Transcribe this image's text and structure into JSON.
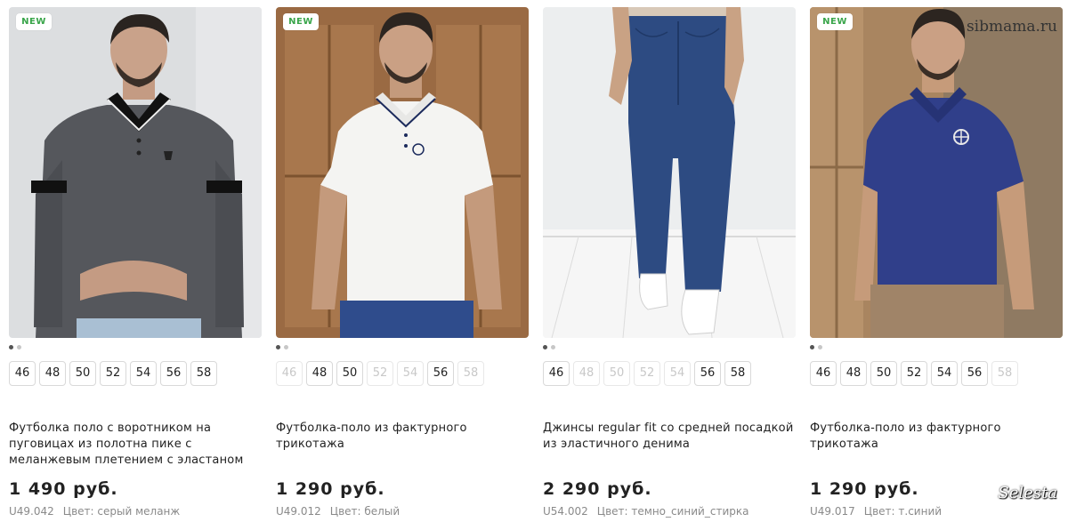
{
  "products": [
    {
      "badge": "NEW",
      "title": "Футболка поло с воротником на пуговицах из полотна пике с меланжевым плетением с эластаном",
      "price": "1 490 руб.",
      "sku": "U49.042",
      "color_label": "Цвет: серый меланж",
      "sizes": [
        {
          "label": "46",
          "available": true
        },
        {
          "label": "48",
          "available": true
        },
        {
          "label": "50",
          "available": true
        },
        {
          "label": "52",
          "available": true
        },
        {
          "label": "54",
          "available": true
        },
        {
          "label": "56",
          "available": true
        },
        {
          "label": "58",
          "available": true
        }
      ],
      "image": {
        "subject": "man in grey polo shirt",
        "bg": "#dadcde",
        "garment": "#55575c",
        "trim": "#111111",
        "lower": "#9fb8cf"
      }
    },
    {
      "badge": "NEW",
      "title": "Футболка-поло из фактурного трикотажа",
      "price": "1 290 руб.",
      "sku": "U49.012",
      "color_label": "Цвет: белый",
      "sizes": [
        {
          "label": "46",
          "available": false
        },
        {
          "label": "48",
          "available": true
        },
        {
          "label": "50",
          "available": true
        },
        {
          "label": "52",
          "available": false
        },
        {
          "label": "54",
          "available": false
        },
        {
          "label": "56",
          "available": true
        },
        {
          "label": "58",
          "available": false
        }
      ],
      "image": {
        "subject": "man in white polo shirt",
        "bg": "#9a6a43",
        "garment": "#f4f4f2",
        "trim": "#1b2a5c",
        "lower": "#2f4c8c"
      }
    },
    {
      "badge": "",
      "title": "Джинсы regular fit со средней посадкой из эластичного денима",
      "price": "2 290 руб.",
      "sku": "U54.002",
      "color_label": "Цвет: темно_синий_стирка",
      "sizes": [
        {
          "label": "46",
          "available": true
        },
        {
          "label": "48",
          "available": false
        },
        {
          "label": "50",
          "available": false
        },
        {
          "label": "52",
          "available": false
        },
        {
          "label": "54",
          "available": false
        },
        {
          "label": "56",
          "available": true
        },
        {
          "label": "58",
          "available": true
        }
      ],
      "image": {
        "subject": "legs in dark blue jeans",
        "bg": "#eceeef",
        "garment": "#2d4b82",
        "trim": "#1f3866",
        "lower": "#ffffff"
      }
    },
    {
      "badge": "NEW",
      "title": "Футболка-поло из фактурного трикотажа",
      "price": "1 290 руб.",
      "sku": "U49.017",
      "color_label": "Цвет: т.синий",
      "sizes": [
        {
          "label": "46",
          "available": true
        },
        {
          "label": "48",
          "available": true
        },
        {
          "label": "50",
          "available": true
        },
        {
          "label": "52",
          "available": true
        },
        {
          "label": "54",
          "available": true
        },
        {
          "label": "56",
          "available": true
        },
        {
          "label": "58",
          "available": false
        }
      ],
      "image": {
        "subject": "man in navy polo shirt",
        "bg": "#b08a64",
        "garment": "#303f8a",
        "trim": "#1a2456",
        "lower": "#a08468"
      }
    }
  ],
  "watermarks": {
    "site": "sibmama.ru",
    "brand": "Selesta",
    "overlay": "Selesta sibmama.ru"
  },
  "colors": {
    "badge_text": "#39a54a",
    "text": "#222222",
    "muted": "#8a8a8a",
    "size_disabled": "#c8c8c8"
  }
}
